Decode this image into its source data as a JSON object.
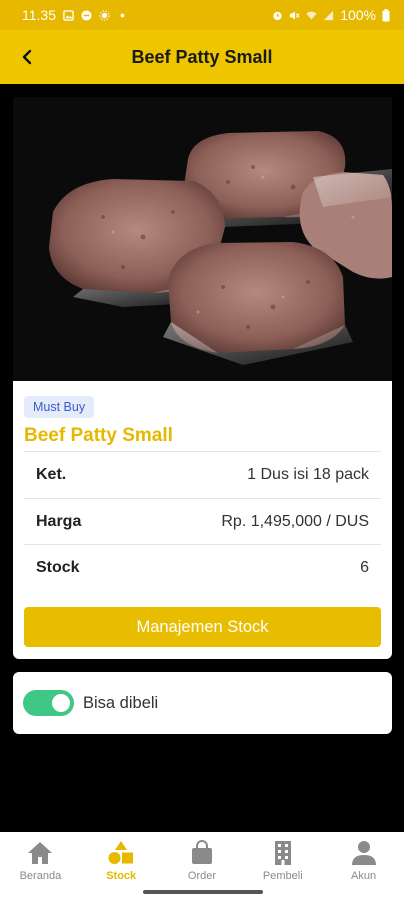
{
  "status_bar": {
    "time": "11.35",
    "battery": "100%"
  },
  "app_bar": {
    "title": "Beef Patty Small",
    "back_icon": "arrow-left-icon"
  },
  "product": {
    "image_alt": "Beef Patty Small",
    "badge": "Must Buy",
    "name": "Beef Patty Small",
    "details": [
      {
        "label": "Ket.",
        "value": "1 Dus isi 18 pack"
      },
      {
        "label": "Harga",
        "value": "Rp. 1,495,000 / DUS"
      },
      {
        "label": "Stock",
        "value": "6"
      }
    ],
    "action_label": "Manajemen Stock"
  },
  "availability": {
    "label": "Bisa dibeli",
    "enabled": true
  },
  "bottom_nav": {
    "items": [
      {
        "label": "Beranda",
        "icon": "home-icon",
        "active": false
      },
      {
        "label": "Stock",
        "icon": "shapes-icon",
        "active": true
      },
      {
        "label": "Order",
        "icon": "bag-icon",
        "active": false
      },
      {
        "label": "Pembeli",
        "icon": "building-icon",
        "active": false
      },
      {
        "label": "Akun",
        "icon": "person-icon",
        "active": false
      }
    ]
  },
  "colors": {
    "primary": "#e8bd00",
    "app_bar": "#eec600",
    "toggle_on": "#3fc785",
    "badge_bg": "#e4ecfb",
    "badge_text": "#3b5bcc"
  }
}
